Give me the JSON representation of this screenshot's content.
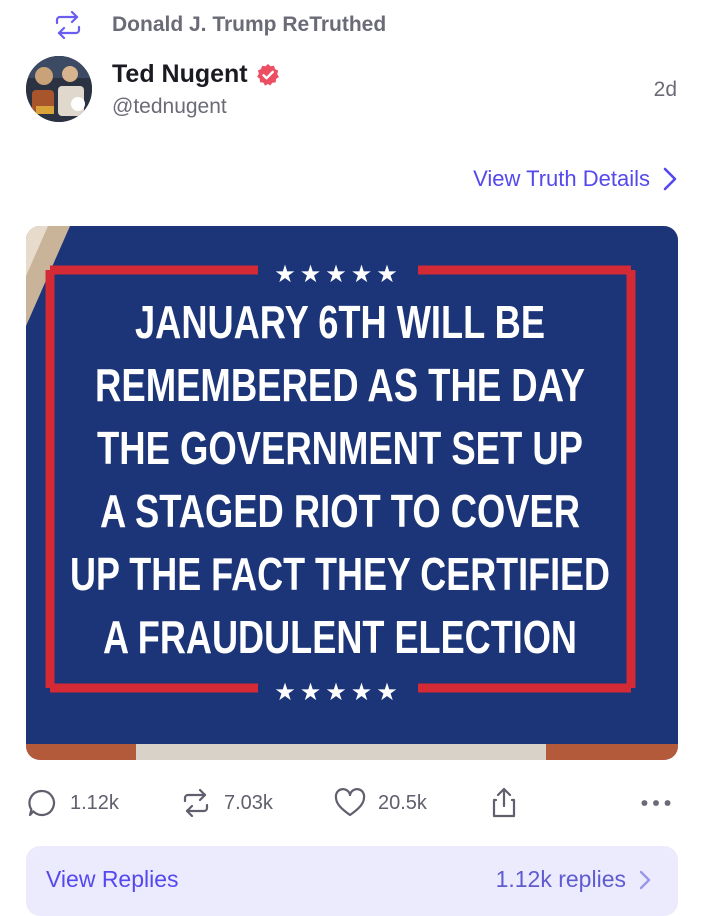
{
  "retruth": {
    "text": "Donald J. Trump ReTruthed",
    "icon": "retruth-icon"
  },
  "author": {
    "display_name": "Ted Nugent",
    "handle": "@tednugent",
    "verified": true,
    "time_ago": "2d",
    "verified_color": "#ee4e62"
  },
  "details_link": {
    "label": "View Truth Details",
    "icon": "chevron-right-icon"
  },
  "media": {
    "lines": [
      "JANUARY 6TH WILL BE",
      "REMEMBERED AS THE DAY",
      "THE GOVERNMENT SET UP",
      "A STAGED RIOT TO COVER",
      "UP THE FACT THEY CERTIFIED",
      "A FRAUDULENT ELECTION"
    ],
    "stars": "★★★★★",
    "background_color": "#1c3478",
    "border_color": "#d42a35"
  },
  "actions": {
    "replies": "1.12k",
    "retruths": "7.03k",
    "likes": "20.5k"
  },
  "view_replies": {
    "label": "View Replies",
    "count": "1.12k replies"
  },
  "colors": {
    "accent": "#5448ee",
    "muted": "#6b6b78",
    "replies_bg": "#ecebfd"
  }
}
